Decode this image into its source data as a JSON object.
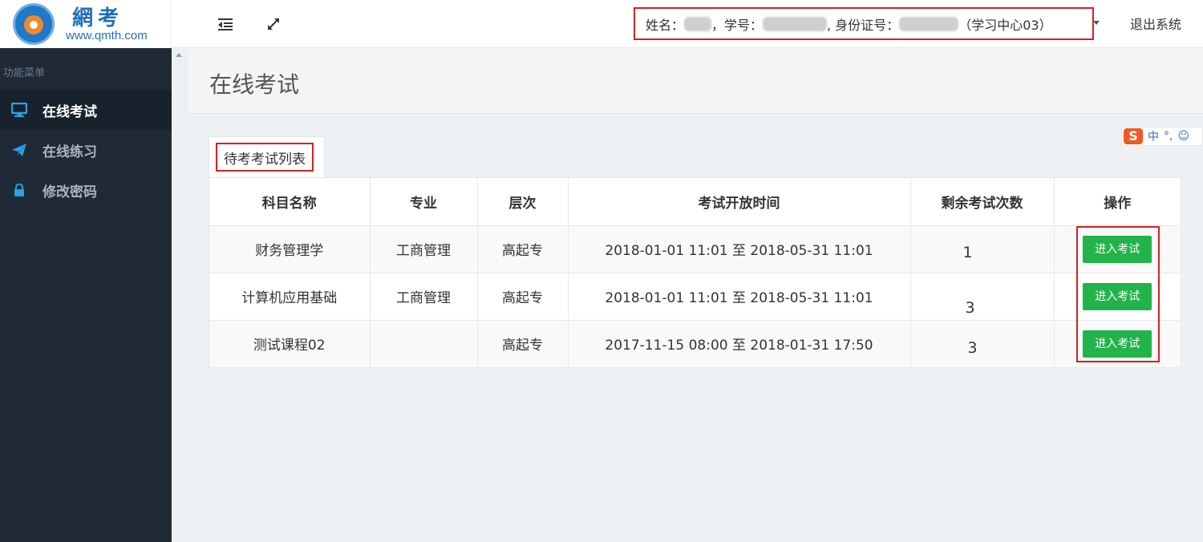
{
  "header": {
    "logo_name": "網考",
    "logo_url": "www.qmth.com",
    "user_info": {
      "name_label": "姓名：",
      "student_no_label": "，学号：",
      "id_label": ", 身份证号：",
      "center": "（学习中心03）"
    },
    "logout_label": "退出系统",
    "icons": {
      "menu_toggle": "outdent-icon",
      "fullscreen": "expand-icon"
    }
  },
  "sidebar": {
    "section_title": "功能菜单",
    "items": [
      {
        "label": "在线考试",
        "icon": "monitor-icon",
        "active": true
      },
      {
        "label": "在线练习",
        "icon": "paper-plane-icon",
        "active": false
      },
      {
        "label": "修改密码",
        "icon": "lock-icon",
        "active": false
      }
    ]
  },
  "main": {
    "page_title": "在线考试",
    "tab_label": "待考考试列表",
    "table": {
      "columns": [
        "科目名称",
        "专业",
        "层次",
        "考试开放时间",
        "剩余考试次数",
        "操作"
      ],
      "rows": [
        {
          "subject": "财务管理学",
          "major": "工商管理",
          "level": "高起专",
          "time": "2018-01-01 11:01 至 2018-05-31 11:01",
          "remaining": "1",
          "action": "进入考试"
        },
        {
          "subject": "计算机应用基础",
          "major": "工商管理",
          "level": "高起专",
          "time": "2018-01-01 11:01 至 2018-05-31 11:01",
          "remaining": "3",
          "action": "进入考试"
        },
        {
          "subject": "测试课程02",
          "major": "",
          "level": "高起专",
          "time": "2017-11-15 08:00 至 2018-01-31 17:50",
          "remaining": "3",
          "action": "进入考试"
        }
      ]
    }
  },
  "ime_toolbar": {
    "logo": "S",
    "mode": "中",
    "punct": "°,",
    "emoji": "☺"
  },
  "colors": {
    "sidebar_bg": "#1f2a36",
    "accent_blue": "#2f9ee3",
    "enter_button": "#22b34b",
    "highlight_red": "#d42020"
  }
}
